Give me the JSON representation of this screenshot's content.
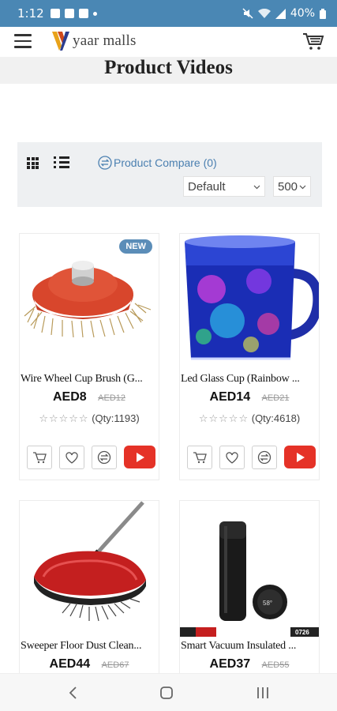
{
  "status_bar": {
    "time": "1:12",
    "battery": "40%"
  },
  "header": {
    "logo_text": "yaar malls",
    "page_title": "Product Videos"
  },
  "toolbar": {
    "compare_label": "Product Compare (0)",
    "sort_value": "Default",
    "limit_value": "500"
  },
  "products": [
    {
      "name": "Wire Wheel Cup Brush (G...",
      "price": "AED8",
      "old_price": "AED12",
      "qty": "(Qty:1193)",
      "badge": "NEW"
    },
    {
      "name": "Led Glass Cup (Rainbow ...",
      "price": "AED14",
      "old_price": "AED21",
      "qty": "(Qty:4618)"
    },
    {
      "name": "Sweeper Floor Dust Clean...",
      "price": "AED44",
      "old_price": "AED67"
    },
    {
      "name": "Smart Vacuum Insulated ...",
      "price": "AED37",
      "old_price": "AED55",
      "image_tag": "0726"
    }
  ],
  "colors": {
    "status_bar": "#4a87b4",
    "accent": "#4a7fb0",
    "youtube": "#e53227"
  }
}
